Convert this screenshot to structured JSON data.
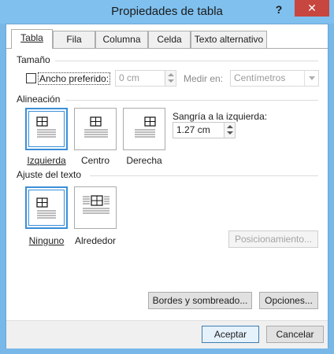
{
  "window": {
    "title": "Propiedades de tabla",
    "help_glyph": "?",
    "close_glyph": "✕"
  },
  "tabs": [
    {
      "label": "Tabla"
    },
    {
      "label": "Fila"
    },
    {
      "label": "Columna"
    },
    {
      "label": "Celda"
    },
    {
      "label": "Texto alternativo"
    }
  ],
  "size": {
    "heading": "Tamaño",
    "preferred_width_label": "Ancho preferido:",
    "preferred_width_checked": false,
    "width_value": "0 cm",
    "measure_label": "Medir en:",
    "measure_value": "Centímetros"
  },
  "alignment": {
    "heading": "Alineación",
    "options": [
      {
        "label": "Izquierda"
      },
      {
        "label": "Centro"
      },
      {
        "label": "Derecha"
      }
    ],
    "indent_label": "Sangría a la izquierda:",
    "indent_value": "1.27 cm"
  },
  "wrapping": {
    "heading": "Ajuste del texto",
    "options": [
      {
        "label": "Ninguno"
      },
      {
        "label": "Alrededor"
      }
    ],
    "positioning_button": "Posicionamiento..."
  },
  "buttons": {
    "borders": "Bordes y sombreado...",
    "options": "Opciones...",
    "ok": "Aceptar",
    "cancel": "Cancelar"
  },
  "colors": {
    "title_bar": "#7fc0ee",
    "close": "#c7463f",
    "selection": "#3a8fd8"
  }
}
